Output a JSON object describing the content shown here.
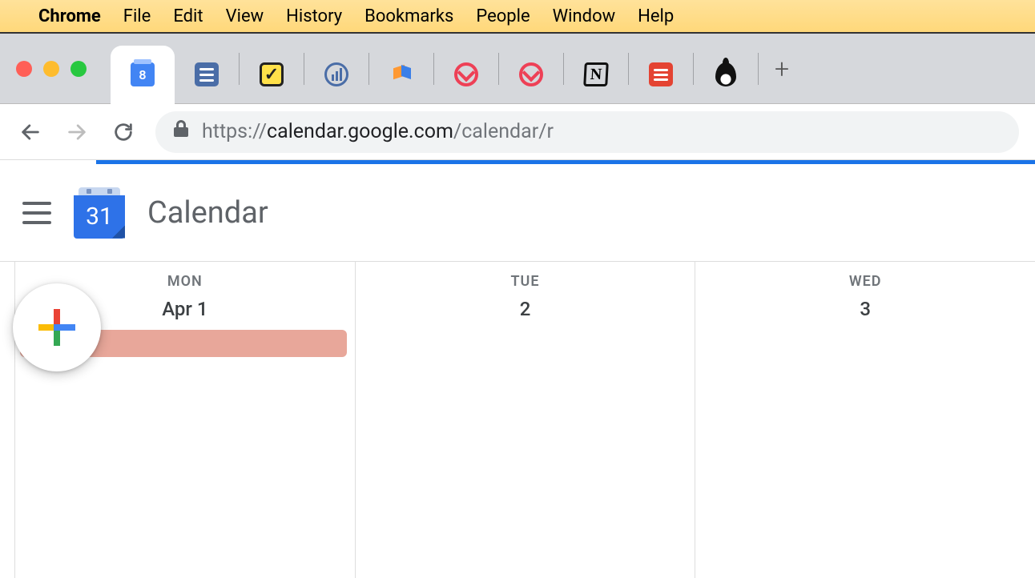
{
  "macos_menu": {
    "app": "Chrome",
    "items": [
      "File",
      "Edit",
      "View",
      "History",
      "Bookmarks",
      "People",
      "Window",
      "Help"
    ]
  },
  "browser": {
    "tabs": {
      "active_favicon_label": "8"
    },
    "url": {
      "scheme": "https://",
      "host": "calendar.google.com",
      "path": "/calendar/r"
    }
  },
  "app": {
    "logo_day": "31",
    "title": "Calendar"
  },
  "calendar": {
    "columns": [
      {
        "dow": "MON",
        "date": "Apr 1",
        "has_event": true
      },
      {
        "dow": "TUE",
        "date": "2",
        "has_event": false
      },
      {
        "dow": "WED",
        "date": "3",
        "has_event": false
      }
    ]
  }
}
